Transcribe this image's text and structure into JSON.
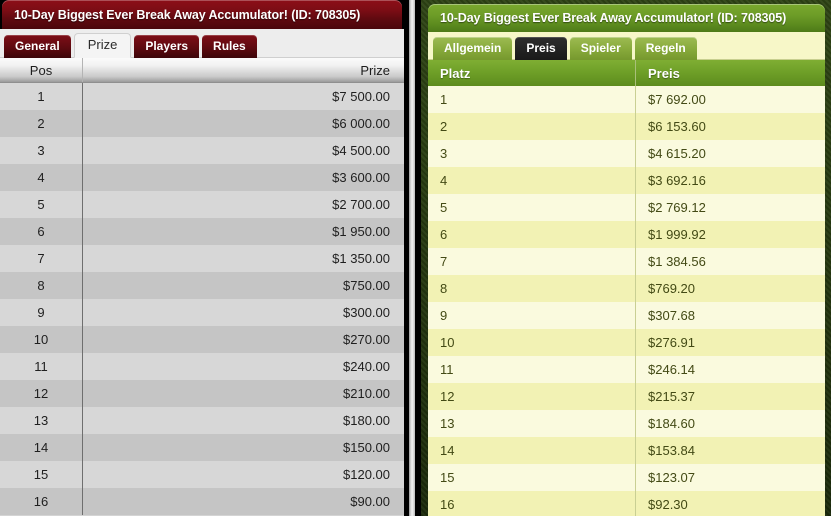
{
  "left_panel": {
    "theme_accent": "#7c0d15",
    "title": "10-Day Biggest Ever Break Away Accumulator! (ID: 708305)",
    "tabs": [
      {
        "label": "General",
        "active": false
      },
      {
        "label": "Prize",
        "active": true
      },
      {
        "label": "Players",
        "active": false
      },
      {
        "label": "Rules",
        "active": false
      }
    ],
    "table": {
      "columns": [
        "Pos",
        "Prize"
      ],
      "rows": [
        {
          "pos": "1",
          "prize": "$7 500.00"
        },
        {
          "pos": "2",
          "prize": "$6 000.00"
        },
        {
          "pos": "3",
          "prize": "$4 500.00"
        },
        {
          "pos": "4",
          "prize": "$3 600.00"
        },
        {
          "pos": "5",
          "prize": "$2 700.00"
        },
        {
          "pos": "6",
          "prize": "$1 950.00"
        },
        {
          "pos": "7",
          "prize": "$1 350.00"
        },
        {
          "pos": "8",
          "prize": "$750.00"
        },
        {
          "pos": "9",
          "prize": "$300.00"
        },
        {
          "pos": "10",
          "prize": "$270.00"
        },
        {
          "pos": "11",
          "prize": "$240.00"
        },
        {
          "pos": "12",
          "prize": "$210.00"
        },
        {
          "pos": "13",
          "prize": "$180.00"
        },
        {
          "pos": "14",
          "prize": "$150.00"
        },
        {
          "pos": "15",
          "prize": "$120.00"
        },
        {
          "pos": "16",
          "prize": "$90.00"
        }
      ]
    }
  },
  "right_panel": {
    "theme_accent": "#6d9c27",
    "title": "10-Day Biggest Ever Break Away Accumulator! (ID: 708305)",
    "tabs": [
      {
        "label": "Allgemein",
        "active": false
      },
      {
        "label": "Preis",
        "active": true
      },
      {
        "label": "Spieler",
        "active": false
      },
      {
        "label": "Regeln",
        "active": false
      }
    ],
    "table": {
      "columns": [
        "Platz",
        "Preis"
      ],
      "rows": [
        {
          "platz": "1",
          "preis": "$7 692.00"
        },
        {
          "platz": "2",
          "preis": "$6 153.60"
        },
        {
          "platz": "3",
          "preis": "$4 615.20"
        },
        {
          "platz": "4",
          "preis": "$3 692.16"
        },
        {
          "platz": "5",
          "preis": "$2 769.12"
        },
        {
          "platz": "6",
          "preis": "$1 999.92"
        },
        {
          "platz": "7",
          "preis": "$1 384.56"
        },
        {
          "platz": "8",
          "preis": "$769.20"
        },
        {
          "platz": "9",
          "preis": "$307.68"
        },
        {
          "platz": "10",
          "preis": "$276.91"
        },
        {
          "platz": "11",
          "preis": "$246.14"
        },
        {
          "platz": "12",
          "preis": "$215.37"
        },
        {
          "platz": "13",
          "preis": "$184.60"
        },
        {
          "platz": "14",
          "preis": "$153.84"
        },
        {
          "platz": "15",
          "preis": "$123.07"
        },
        {
          "platz": "16",
          "preis": "$92.30"
        }
      ]
    }
  }
}
